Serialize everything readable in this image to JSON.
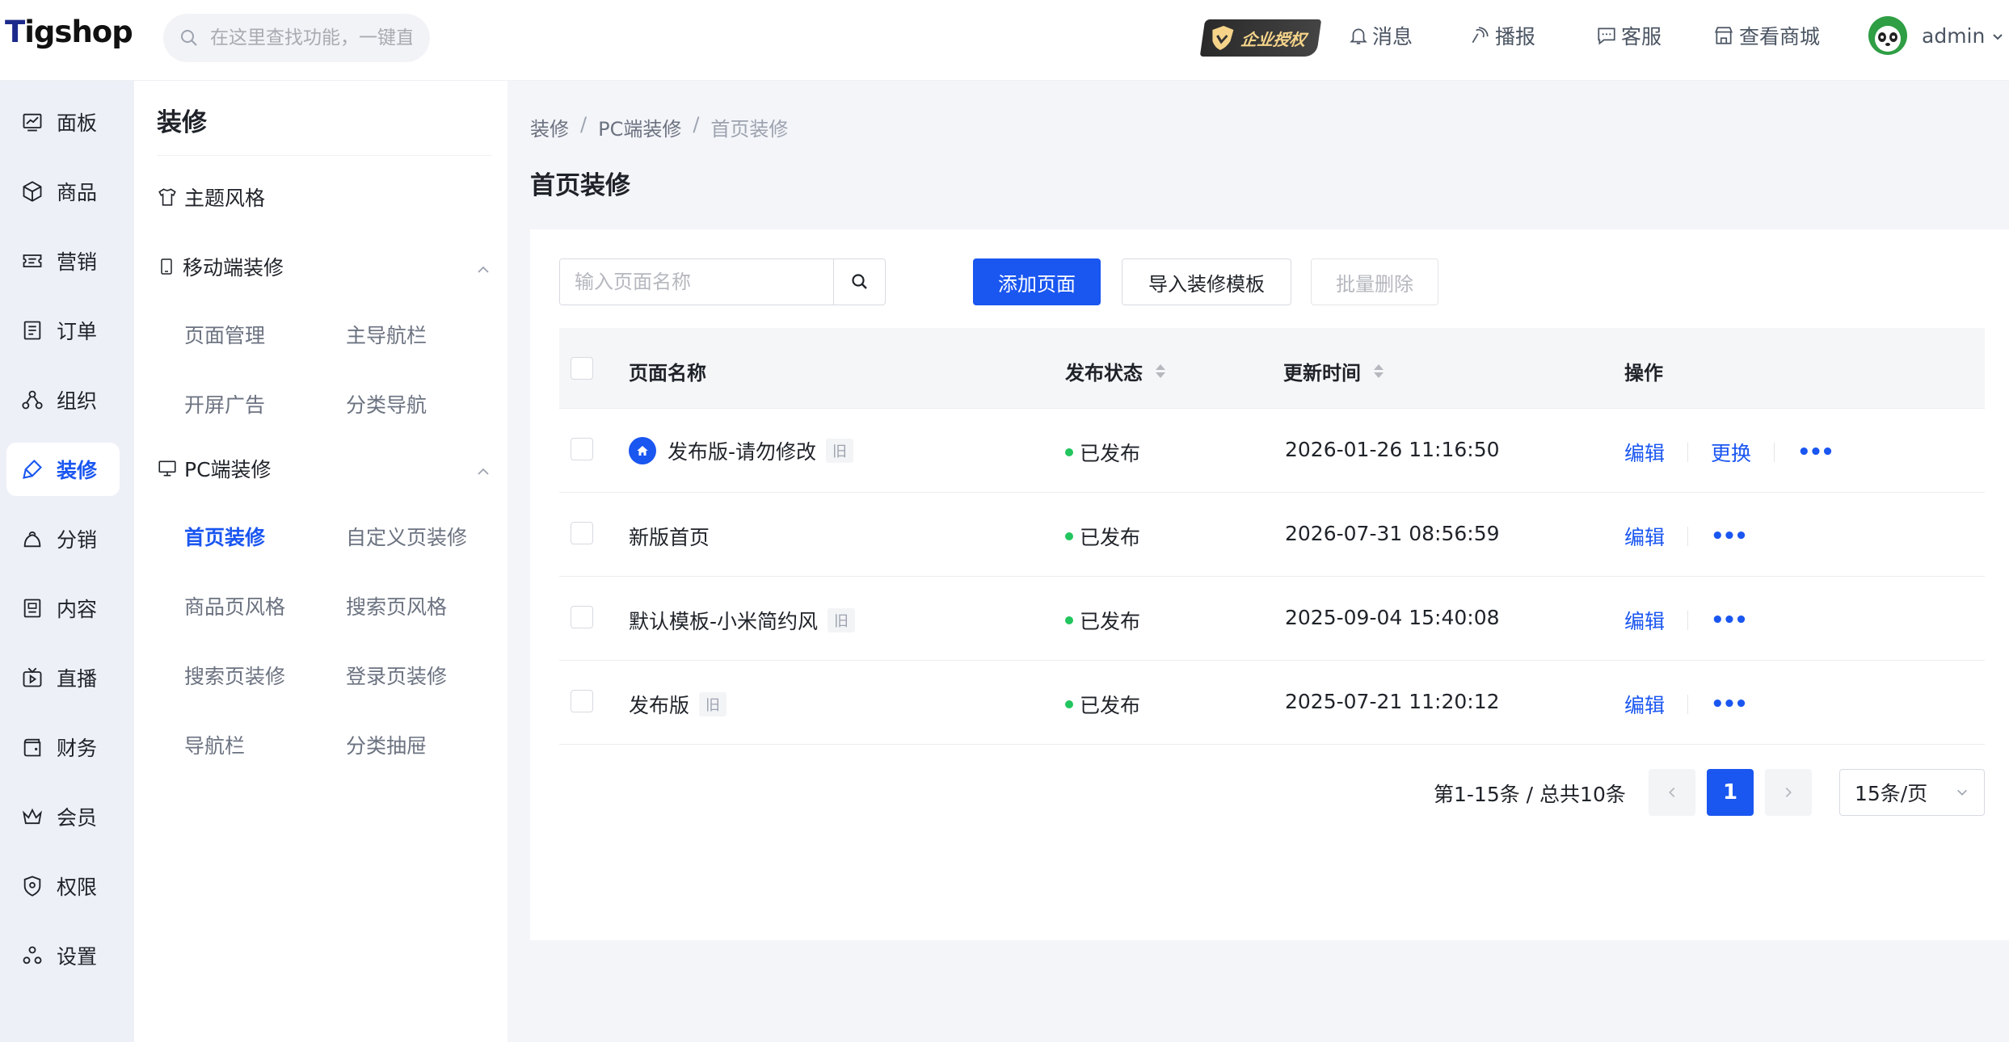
{
  "header": {
    "logo": "Tigshop",
    "search_placeholder": "在这里查找功能，一键直达",
    "badge": "企业授权",
    "nav": [
      {
        "label": "消息",
        "icon": "bell-icon"
      },
      {
        "label": "播报",
        "icon": "broadcast-icon"
      },
      {
        "label": "客服",
        "icon": "chat-icon"
      },
      {
        "label": "查看商城",
        "icon": "store-icon"
      }
    ],
    "user": "admin"
  },
  "sidebar": {
    "items": [
      {
        "label": "面板",
        "icon": "dashboard-icon"
      },
      {
        "label": "商品",
        "icon": "box-icon"
      },
      {
        "label": "营销",
        "icon": "ticket-icon"
      },
      {
        "label": "订单",
        "icon": "order-icon"
      },
      {
        "label": "组织",
        "icon": "org-icon"
      },
      {
        "label": "装修",
        "icon": "brush-icon",
        "active": true
      },
      {
        "label": "分销",
        "icon": "share-icon"
      },
      {
        "label": "内容",
        "icon": "content-icon"
      },
      {
        "label": "直播",
        "icon": "live-icon"
      },
      {
        "label": "财务",
        "icon": "wallet-icon"
      },
      {
        "label": "会员",
        "icon": "crown-icon"
      },
      {
        "label": "权限",
        "icon": "shield-icon"
      },
      {
        "label": "设置",
        "icon": "settings-icon"
      }
    ]
  },
  "subsidebar": {
    "title": "装修",
    "theme": "主题风格",
    "mobile_group": "移动端装修",
    "mobile_links": [
      "页面管理",
      "主导航栏",
      "开屏广告",
      "分类导航"
    ],
    "pc_group": "PC端装修",
    "pc_links": [
      "首页装修",
      "自定义页装修",
      "商品页风格",
      "搜索页风格",
      "搜索页装修",
      "登录页装修",
      "导航栏",
      "分类抽屉"
    ]
  },
  "breadcrumb": [
    "装修",
    "PC端装修",
    "首页装修"
  ],
  "page_title": "首页装修",
  "toolbar": {
    "search_placeholder": "输入页面名称",
    "add_label": "添加页面",
    "import_label": "导入装修模板",
    "batch_delete_label": "批量删除"
  },
  "table": {
    "columns": [
      "页面名称",
      "发布状态",
      "更新时间",
      "操作"
    ],
    "rows": [
      {
        "name": "发布版-请勿修改",
        "tag": "旧",
        "home": true,
        "status": "已发布",
        "updated": "2026-01-26 11:16:50",
        "actions": [
          "编辑",
          "更换"
        ]
      },
      {
        "name": "新版首页",
        "tag": "",
        "home": false,
        "status": "已发布",
        "updated": "2026-07-31 08:56:59",
        "actions": [
          "编辑"
        ]
      },
      {
        "name": "默认模板-小米简约风",
        "tag": "旧",
        "home": false,
        "status": "已发布",
        "updated": "2025-09-04 15:40:08",
        "actions": [
          "编辑"
        ]
      },
      {
        "name": "发布版",
        "tag": "旧",
        "home": false,
        "status": "已发布",
        "updated": "2025-07-21 11:20:12",
        "actions": [
          "编辑"
        ]
      }
    ]
  },
  "pagination": {
    "summary": "第1-15条 / 总共10条",
    "current": "1",
    "page_size": "15条/页"
  },
  "colors": {
    "accent": "#1a56f0",
    "published": "#22c55e"
  }
}
